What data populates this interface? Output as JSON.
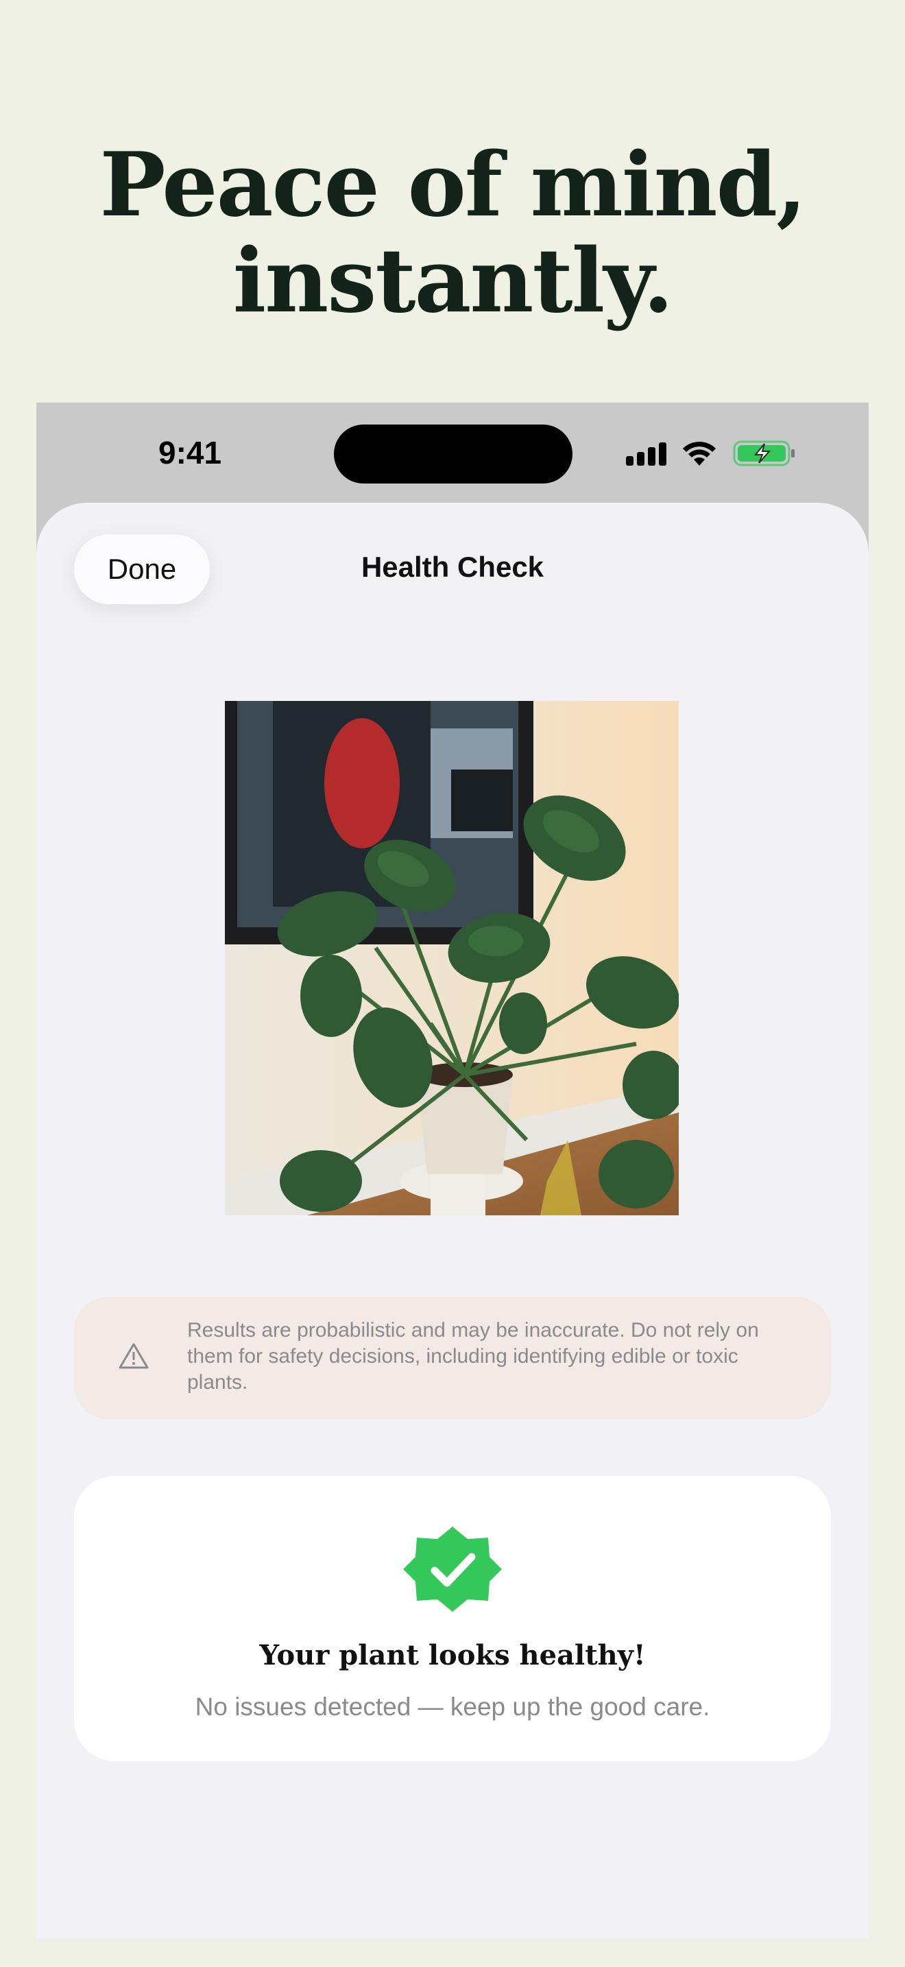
{
  "headline": {
    "line1": "Peace of mind,",
    "line2": "instantly."
  },
  "status_bar": {
    "time": "9:41",
    "icons": [
      "cellular-signal-icon",
      "wifi-icon",
      "battery-charging-icon"
    ]
  },
  "nav": {
    "done_label": "Done",
    "title": "Health Check"
  },
  "photo": {
    "subject": "monstera-plant-photo"
  },
  "disclaimer": {
    "icon": "warning-triangle-icon",
    "text": "Results are probabilistic and may be inaccurate. Do not rely on them for safety decisions, including identifying edible or toxic plants."
  },
  "result": {
    "icon": "check-badge-icon",
    "title": "Your plant looks healthy!",
    "subtitle": "No issues detected — keep up the good care."
  },
  "colors": {
    "page_background": "#eff1e4",
    "headline": "#13231a",
    "sheet_background": "#f2f1f6",
    "disclaimer_background": "#f3e9e5",
    "success_green": "#34c759",
    "secondary_text": "#8a8a8e"
  }
}
